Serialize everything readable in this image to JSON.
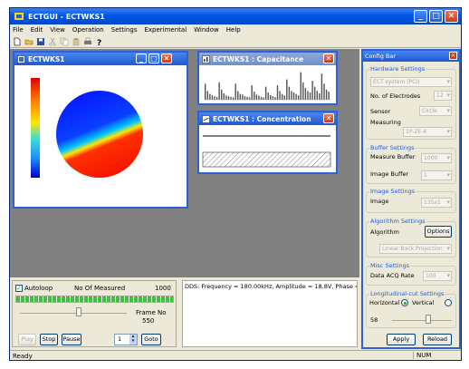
{
  "app": {
    "title": "ECTGUI - ECTWKS1",
    "menu": [
      "File",
      "Edit",
      "View",
      "Operation",
      "Settings",
      "Experimental",
      "Window",
      "Help"
    ]
  },
  "windows": {
    "image": {
      "title": "ECTWKS1"
    },
    "capacitance": {
      "title": "ECTWKS1 : Capacitance",
      "bars": [
        0.55,
        0.3,
        0.2,
        0.15,
        0.12,
        0.1,
        0.6,
        0.35,
        0.22,
        0.15,
        0.12,
        0.1,
        0.08,
        0.55,
        0.3,
        0.2,
        0.18,
        0.12,
        0.1,
        0.08,
        0.5,
        0.28,
        0.18,
        0.14,
        0.1,
        0.08,
        0.45,
        0.25,
        0.16,
        0.12,
        0.09,
        0.5,
        0.3,
        0.2,
        0.15,
        0.7,
        0.45,
        0.3,
        0.25,
        0.2,
        0.15,
        0.95,
        0.6,
        0.4,
        0.3,
        0.25,
        0.65,
        0.45,
        0.3,
        0.22,
        0.9,
        0.55,
        0.35,
        0.28
      ]
    },
    "concentration": {
      "title": "ECTWKS1 : Concentration"
    }
  },
  "bottom": {
    "autoloop_label": "Autoloop",
    "measured_label": "No Of Measured",
    "measured_value": "1000",
    "frame_label": "Frame No",
    "frame_value": "550",
    "progress_fraction": 1.0,
    "frame_slider_fraction": 0.55,
    "buttons": {
      "play": "Play",
      "stop": "Stop",
      "pause": "Pause",
      "goto": "Goto"
    },
    "spin_value": "1",
    "dds_text": "DDS: Frequency = 180.00kHz, Amplitude = 18.8V, Phase = 90.00"
  },
  "status": {
    "left": "Ready",
    "right": "NUM"
  },
  "config": {
    "title": "Config Bar",
    "hardware": {
      "title": "Hardware Settings",
      "system": "ECT system (PCI)",
      "electrodes_label": "No. of Electrodes",
      "electrodes_value": "12",
      "sensor_label": "Sensor",
      "sensor_value": "Circle",
      "measuring_label": "Measuring",
      "measuring_value": "1P-2E-4"
    },
    "buffer": {
      "title": "Buffer Settings",
      "measure_label": "Measure Buffer",
      "measure_value": "1000",
      "image_label": "Image Buffer",
      "image_value": "1"
    },
    "image": {
      "title": "Image Settings",
      "label": "Image",
      "value": "135x1"
    },
    "algorithm": {
      "title": "Algorithm Settings",
      "label": "Algorithm",
      "options_button": "Options",
      "value": "Linear Back Projection"
    },
    "misc": {
      "title": "Misc Settings",
      "label": "Data ACQ Rate",
      "value": "100"
    },
    "longitudinal": {
      "title": "Longitudinal-cut Settings",
      "horizontal": "Horizontal",
      "vertical": "Vertical",
      "value": "58",
      "slider_fraction": 0.6
    },
    "buttons": {
      "apply": "Apply",
      "reload": "Reload"
    }
  },
  "colors": {
    "title_blue": "#0058E6",
    "desktop_gray": "#808080",
    "progress_green": "#3CC13C"
  }
}
